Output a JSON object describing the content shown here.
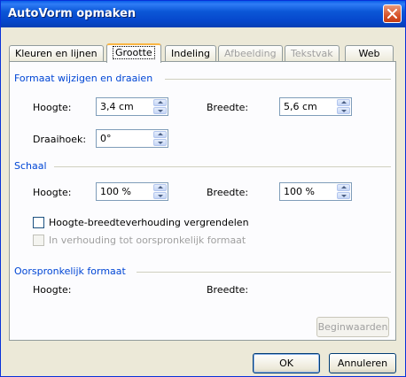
{
  "window": {
    "title": "AutoVorm opmaken"
  },
  "tabs": [
    {
      "label": "Kleuren en lijnen",
      "disabled": false
    },
    {
      "label": "Grootte",
      "active": true
    },
    {
      "label": "Indeling",
      "disabled": false
    },
    {
      "label": "Afbeelding",
      "disabled": true
    },
    {
      "label": "Tekstvak",
      "disabled": true
    },
    {
      "label": "Web",
      "disabled": false
    }
  ],
  "size_section": {
    "title": "Formaat wijzigen en draaien",
    "height_label": "Hoogte:",
    "height_value": "3,4 cm",
    "width_label": "Breedte:",
    "width_value": "5,6 cm",
    "rotation_label": "Draaihoek:",
    "rotation_value": "0°"
  },
  "scale_section": {
    "title": "Schaal",
    "height_label": "Hoogte:",
    "height_value": "100 %",
    "width_label": "Breedte:",
    "width_value": "100 %",
    "lock_aspect_label": "Hoogte-breedteverhouding vergrendelen",
    "lock_aspect_checked": false,
    "relative_original_label": "In verhouding tot oorspronkelijk formaat",
    "relative_original_checked": false
  },
  "original_section": {
    "title": "Oorspronkelijk formaat",
    "height_label": "Hoogte:",
    "width_label": "Breedte:",
    "reset_label": "Beginwaarden"
  },
  "buttons": {
    "ok": "OK",
    "cancel": "Annuleren"
  }
}
